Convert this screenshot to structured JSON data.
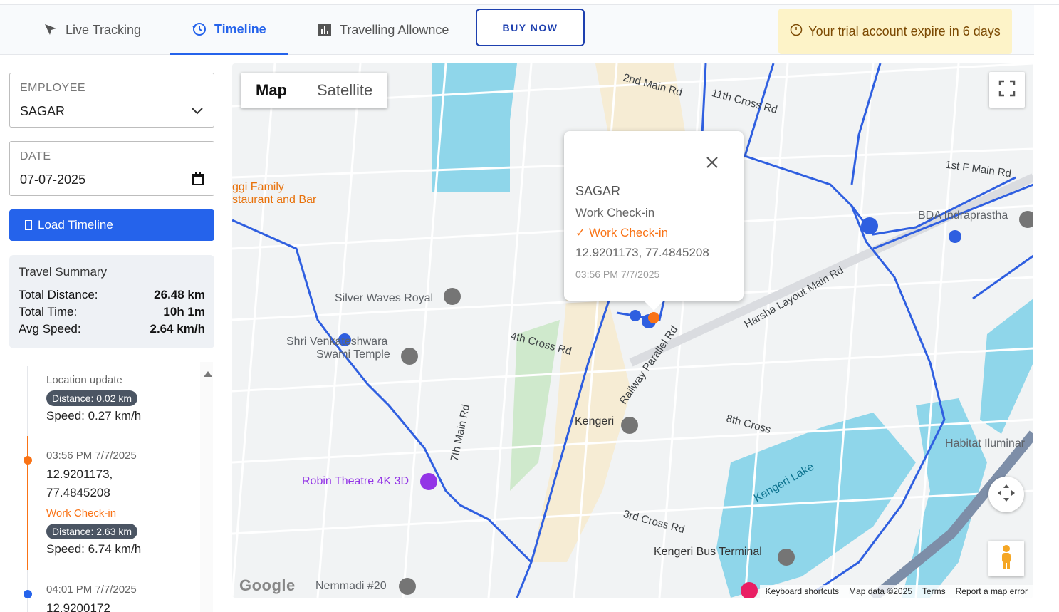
{
  "tabs": [
    {
      "label": "Live Tracking",
      "icon": "location-icon",
      "active": false
    },
    {
      "label": "Timeline",
      "icon": "history-icon",
      "active": true
    },
    {
      "label": "Travelling Allownce",
      "icon": "bar-chart-icon",
      "active": false
    }
  ],
  "buy_now": "BUY NOW",
  "trial_notice": "Your trial account expire in 6 days",
  "employee": {
    "label": "EMPLOYEE",
    "value": "SAGAR"
  },
  "date": {
    "label": "DATE",
    "value": "07-07-2025"
  },
  "load_button": "Load Timeline",
  "summary": {
    "title": "Travel Summary",
    "rows": [
      {
        "label": "Total Distance:",
        "value": "26.48 km"
      },
      {
        "label": "Total Time:",
        "value": "10h 1m"
      },
      {
        "label": "Avg Speed:",
        "value": "2.64 km/h"
      }
    ]
  },
  "timeline": {
    "item1": {
      "title": "Location update",
      "distance": "Distance: 0.02 km",
      "speed": "Speed: 0.27 km/h"
    },
    "item2": {
      "time": "03:56 PM 7/7/2025",
      "lat": "12.9201173,",
      "lng": "77.4845208",
      "type": "Work Check-in",
      "distance": "Distance: 2.63 km",
      "speed": "Speed: 6.74 km/h"
    },
    "item3": {
      "time": "04:01 PM 7/7/2025",
      "lat": "12.9200172"
    }
  },
  "map": {
    "type_map": "Map",
    "type_satellite": "Satellite",
    "popup": {
      "name": "SAGAR",
      "type": "Work Check-in",
      "status": "✓ Work Check-in",
      "coords": "12.9201173, 77.4845208",
      "time": "03:56 PM 7/7/2025"
    },
    "labels": {
      "l1": "Silver Waves Royal",
      "l2": "Shri Venkateshwara",
      "l3": "Swami Temple",
      "l4": "ggi Family",
      "l5": "staurant and Bar",
      "l6": "Robin Theatre 4K 3D",
      "l7": "Kengeri",
      "l8": "Kengeri Bus Terminal",
      "l9": "Kengeri Lake",
      "l10": "BDA Indraprastha",
      "l11": "Habitat Iluminar",
      "l12": "Nemmadi #20",
      "l13": "2nd Main Rd",
      "l14": "11th Cross Rd",
      "l15": "1st F Main Rd",
      "l16": "4th Cross Rd",
      "l17": "Harsha Layout Main Rd",
      "l18": "Railway Parallel Rd",
      "l19": "7th Main Rd",
      "l20": "3rd Cross Rd",
      "l21": "8th Cross"
    },
    "attribution": {
      "shortcuts": "Keyboard shortcuts",
      "data": "Map data ©2025",
      "terms": "Terms",
      "report": "Report a map error"
    },
    "logo": "Google"
  },
  "colors": {
    "primary": "#2563eb",
    "accent": "#f97316",
    "route": "#2f5fe0"
  }
}
